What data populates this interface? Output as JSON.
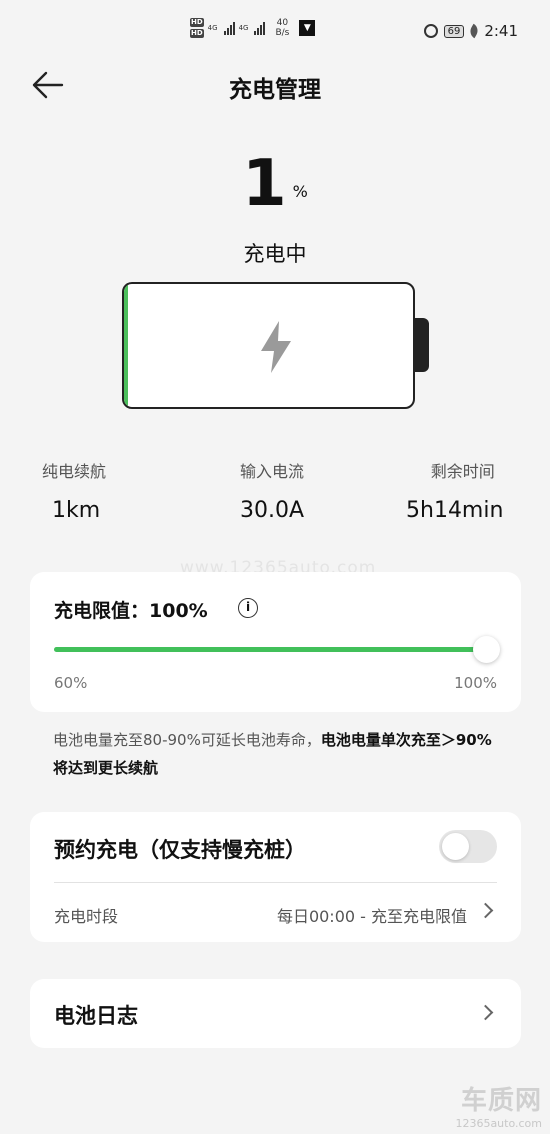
{
  "status_bar": {
    "hd1": "HD",
    "hd2": "HD",
    "net1": "4G",
    "net2": "4G",
    "speed_value": "40",
    "speed_unit": "B/s",
    "battery_level": "69",
    "time": "2:41"
  },
  "header": {
    "title": "充电管理"
  },
  "battery": {
    "percent": "1",
    "unit": "%",
    "status": "充电中",
    "fill_fraction": 0.01
  },
  "stats": [
    {
      "label": "纯电续航",
      "value": "1km"
    },
    {
      "label": "输入电流",
      "value": "30.0A"
    },
    {
      "label": "剩余时间",
      "value": "5h14min"
    }
  ],
  "watermark": "www.12365auto.com",
  "charge_limit": {
    "title": "充电限值：100%",
    "info_symbol": "i",
    "min_label": "60%",
    "max_label": "100%",
    "value_percent": 100
  },
  "tip": {
    "normal": "电池电量充至80-90%可延长电池寿命，",
    "bold": "电池电量单次充至＞90%将达到更长续航"
  },
  "schedule": {
    "title": "预约充电（仅支持慢充桩）",
    "enabled": false,
    "row_label": "充电时段",
    "row_value": "每日00:00 - 充至充电限值"
  },
  "battery_log": {
    "title": "电池日志"
  },
  "brand": {
    "main": "车质网",
    "sub": "12365auto.com"
  },
  "colors": {
    "accent": "#41c05a",
    "background": "#f4f4f4"
  }
}
